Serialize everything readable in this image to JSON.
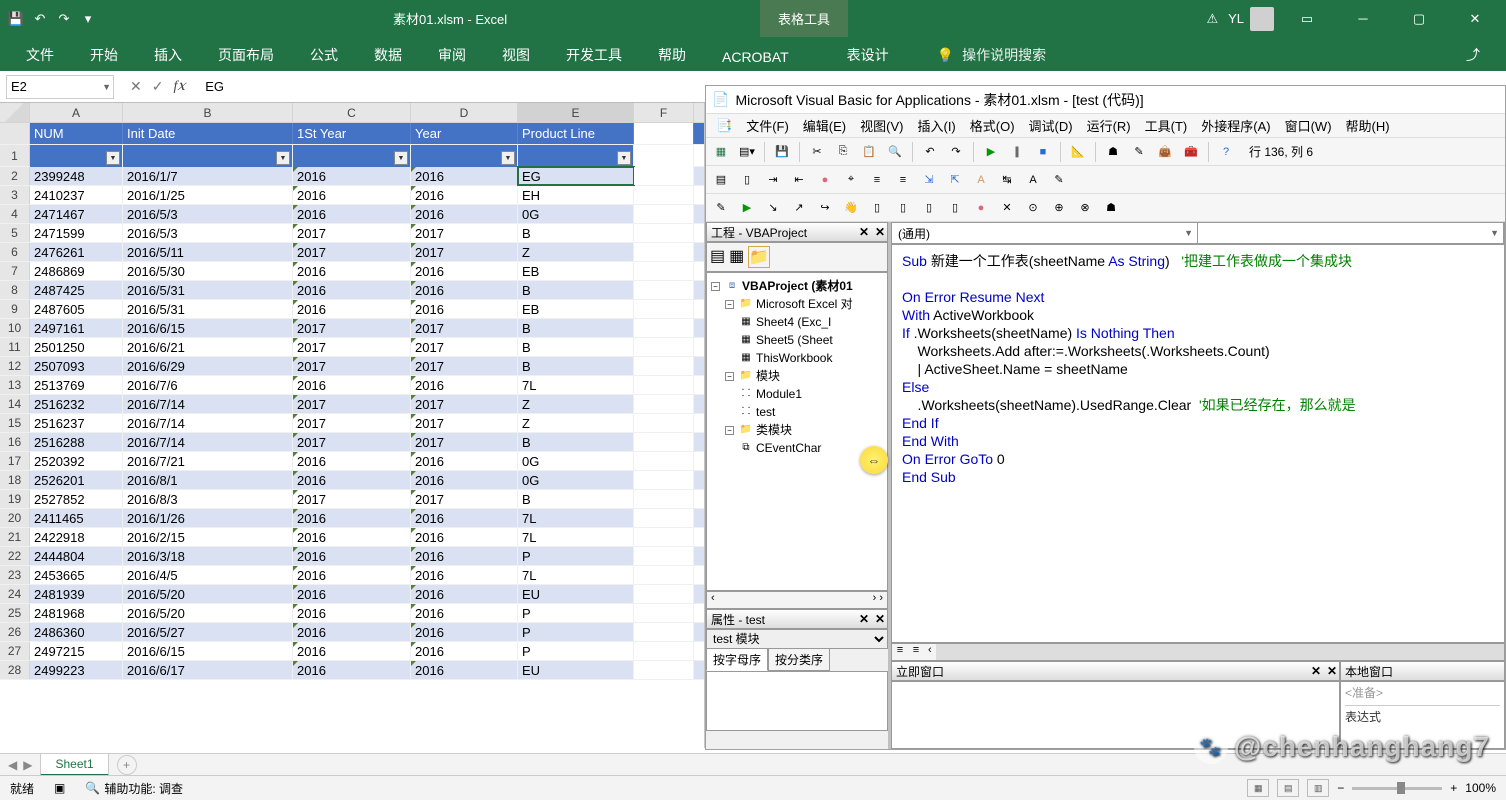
{
  "title_bar": {
    "file_title": "素材01.xlsm  -  Excel",
    "contextual": "表格工具",
    "user": "YL",
    "warning": "⚠"
  },
  "ribbon": {
    "tabs": [
      "文件",
      "开始",
      "插入",
      "页面布局",
      "公式",
      "数据",
      "审阅",
      "视图",
      "开发工具",
      "帮助",
      "ACROBAT",
      "表设计"
    ],
    "tell_me": "操作说明搜索"
  },
  "formula_bar": {
    "name_box": "E2",
    "cancel": "✕",
    "enter": "✓",
    "fx": "f𝑥",
    "formula": "EG"
  },
  "columns": [
    "A",
    "B",
    "C",
    "D",
    "E",
    "F"
  ],
  "headers": {
    "NUM": "NUM",
    "InitDate": "Init Date",
    "FirstYear": "1St Year",
    "Year": "Year",
    "ProductLine": "Product Line"
  },
  "rows": [
    {
      "n": "2",
      "NUM": "2399248",
      "InitDate": "2016/1/7",
      "FirstYear": "2016",
      "Year": "2016",
      "ProductLine": "EG"
    },
    {
      "n": "3",
      "NUM": "2410237",
      "InitDate": "2016/1/25",
      "FirstYear": "2016",
      "Year": "2016",
      "ProductLine": "EH"
    },
    {
      "n": "4",
      "NUM": "2471467",
      "InitDate": "2016/5/3",
      "FirstYear": "2016",
      "Year": "2016",
      "ProductLine": "0G"
    },
    {
      "n": "5",
      "NUM": "2471599",
      "InitDate": "2016/5/3",
      "FirstYear": "2017",
      "Year": "2017",
      "ProductLine": "B"
    },
    {
      "n": "6",
      "NUM": "2476261",
      "InitDate": "2016/5/11",
      "FirstYear": "2017",
      "Year": "2017",
      "ProductLine": "Z"
    },
    {
      "n": "7",
      "NUM": "2486869",
      "InitDate": "2016/5/30",
      "FirstYear": "2016",
      "Year": "2016",
      "ProductLine": "EB"
    },
    {
      "n": "8",
      "NUM": "2487425",
      "InitDate": "2016/5/31",
      "FirstYear": "2016",
      "Year": "2016",
      "ProductLine": "B"
    },
    {
      "n": "9",
      "NUM": "2487605",
      "InitDate": "2016/5/31",
      "FirstYear": "2016",
      "Year": "2016",
      "ProductLine": "EB"
    },
    {
      "n": "10",
      "NUM": "2497161",
      "InitDate": "2016/6/15",
      "FirstYear": "2017",
      "Year": "2017",
      "ProductLine": "B"
    },
    {
      "n": "11",
      "NUM": "2501250",
      "InitDate": "2016/6/21",
      "FirstYear": "2017",
      "Year": "2017",
      "ProductLine": "B"
    },
    {
      "n": "12",
      "NUM": "2507093",
      "InitDate": "2016/6/29",
      "FirstYear": "2017",
      "Year": "2017",
      "ProductLine": "B"
    },
    {
      "n": "13",
      "NUM": "2513769",
      "InitDate": "2016/7/6",
      "FirstYear": "2016",
      "Year": "2016",
      "ProductLine": "7L"
    },
    {
      "n": "14",
      "NUM": "2516232",
      "InitDate": "2016/7/14",
      "FirstYear": "2017",
      "Year": "2017",
      "ProductLine": "Z"
    },
    {
      "n": "15",
      "NUM": "2516237",
      "InitDate": "2016/7/14",
      "FirstYear": "2017",
      "Year": "2017",
      "ProductLine": "Z"
    },
    {
      "n": "16",
      "NUM": "2516288",
      "InitDate": "2016/7/14",
      "FirstYear": "2017",
      "Year": "2017",
      "ProductLine": "B"
    },
    {
      "n": "17",
      "NUM": "2520392",
      "InitDate": "2016/7/21",
      "FirstYear": "2016",
      "Year": "2016",
      "ProductLine": "0G"
    },
    {
      "n": "18",
      "NUM": "2526201",
      "InitDate": "2016/8/1",
      "FirstYear": "2016",
      "Year": "2016",
      "ProductLine": "0G"
    },
    {
      "n": "19",
      "NUM": "2527852",
      "InitDate": "2016/8/3",
      "FirstYear": "2017",
      "Year": "2017",
      "ProductLine": "B"
    },
    {
      "n": "20",
      "NUM": "2411465",
      "InitDate": "2016/1/26",
      "FirstYear": "2016",
      "Year": "2016",
      "ProductLine": "7L"
    },
    {
      "n": "21",
      "NUM": "2422918",
      "InitDate": "2016/2/15",
      "FirstYear": "2016",
      "Year": "2016",
      "ProductLine": "7L"
    },
    {
      "n": "22",
      "NUM": "2444804",
      "InitDate": "2016/3/18",
      "FirstYear": "2016",
      "Year": "2016",
      "ProductLine": "P"
    },
    {
      "n": "23",
      "NUM": "2453665",
      "InitDate": "2016/4/5",
      "FirstYear": "2016",
      "Year": "2016",
      "ProductLine": "7L"
    },
    {
      "n": "24",
      "NUM": "2481939",
      "InitDate": "2016/5/20",
      "FirstYear": "2016",
      "Year": "2016",
      "ProductLine": "EU"
    },
    {
      "n": "25",
      "NUM": "2481968",
      "InitDate": "2016/5/20",
      "FirstYear": "2016",
      "Year": "2016",
      "ProductLine": "P"
    },
    {
      "n": "26",
      "NUM": "2486360",
      "InitDate": "2016/5/27",
      "FirstYear": "2016",
      "Year": "2016",
      "ProductLine": "P"
    },
    {
      "n": "27",
      "NUM": "2497215",
      "InitDate": "2016/6/15",
      "FirstYear": "2016",
      "Year": "2016",
      "ProductLine": "P"
    },
    {
      "n": "28",
      "NUM": "2499223",
      "InitDate": "2016/6/17",
      "FirstYear": "2016",
      "Year": "2016",
      "ProductLine": "EU"
    }
  ],
  "sheet_tabs": {
    "active": "Sheet1"
  },
  "status_bar": {
    "mode": "就绪",
    "accessibility": "辅助功能: 调查",
    "zoom": "100%"
  },
  "vba": {
    "title": "Microsoft Visual Basic for Applications - 素材01.xlsm - [test (代码)]",
    "menu": [
      "文件(F)",
      "编辑(E)",
      "视图(V)",
      "插入(I)",
      "格式(O)",
      "调试(D)",
      "运行(R)",
      "工具(T)",
      "外接程序(A)",
      "窗口(W)",
      "帮助(H)"
    ],
    "cursor_pos": "行 136, 列 6",
    "project_panel": "工程 - VBAProject",
    "project_root": "VBAProject (素材01",
    "excel_objects": "Microsoft Excel 对",
    "sheet4": "Sheet4 (Exc_I",
    "sheet5": "Sheet5 (Sheet",
    "thiswb": "ThisWorkbook",
    "modules": "模块",
    "module1": "Module1",
    "test": "test",
    "class_modules": "类模块",
    "ceventchar": "CEventChar",
    "properties_panel": "属性 - test",
    "prop_combo": "test 模块",
    "prop_tab1": "按字母序",
    "prop_tab2": "按分类序",
    "code_combo_left": "(通用)",
    "immediate": "立即窗口",
    "locals": "本地窗口",
    "locals_placeholder": "<准备>",
    "locals_expr": "表达式",
    "code": {
      "l1a": "Sub ",
      "l1b": "新建一个工作表(sheetName ",
      "l1c": "As String",
      "l1d": ")   ",
      "l1e": "'把建工作表做成一个集成块",
      "l2": "",
      "l3": "On Error Resume Next",
      "l4": "With ",
      "l4b": "ActiveWorkbook",
      "l5": "If ",
      "l5b": ".Worksheets(sheetName) ",
      "l5c": "Is Nothing Then",
      "l6": "    Worksheets.Add after:=.Worksheets(.Worksheets.Count)",
      "l7": "    | ActiveSheet.Name = sheetName",
      "l8": "Else",
      "l9": "    .Worksheets(sheetName).UsedRange.Clear  ",
      "l9b": "'如果已经存在，那么就是",
      "l10": "End If",
      "l11": "End With",
      "l12": "On Error GoTo ",
      "l12b": "0",
      "l13": "End Sub"
    }
  },
  "watermark": "@chenhanghang7"
}
